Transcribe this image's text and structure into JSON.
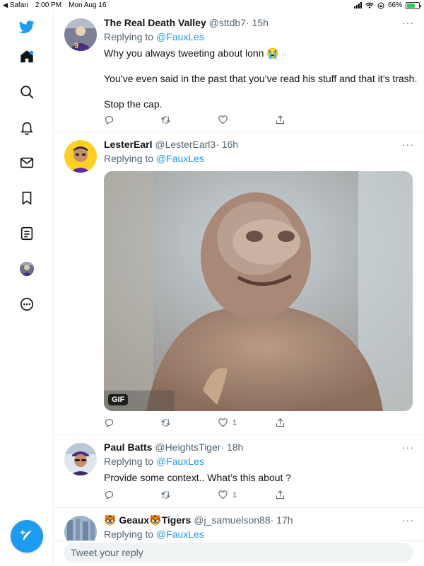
{
  "status_bar": {
    "back_app": "Safari",
    "time": "2:00 PM",
    "date": "Mon Aug 16",
    "battery": "66%",
    "battery_level": 0.66
  },
  "sidebar": {
    "items": [
      {
        "icon": "twitter-bird-icon"
      },
      {
        "icon": "home-icon"
      },
      {
        "icon": "search-icon"
      },
      {
        "icon": "bell-icon"
      },
      {
        "icon": "mail-icon"
      },
      {
        "icon": "bookmark-icon"
      },
      {
        "icon": "list-icon"
      },
      {
        "icon": "profile-avatar"
      },
      {
        "icon": "more-icon"
      }
    ],
    "compose_icon": "compose-icon",
    "accent": "#1d9bf0"
  },
  "tweets": [
    {
      "name": "The Real Death Valley",
      "handle": "@sttdb7",
      "time": "· 15h",
      "replying_prefix": "Replying to",
      "replying_to": "@FauxLes",
      "lines": [
        "Why you always tweeting about lonn 😭",
        "You’ve even said in the past that you’ve read his stuff and that it’s trash.",
        "Stop the cap."
      ],
      "like_count": ""
    },
    {
      "name": "LesterEarl",
      "handle": "@LesterEarl3",
      "time": "· 16h",
      "replying_prefix": "Replying to",
      "replying_to": "@FauxLes",
      "media_badge": "GIF",
      "like_count": "1"
    },
    {
      "name": "Paul Batts",
      "handle": "@HeightsTiger",
      "time": "· 18h",
      "replying_prefix": "Replying to",
      "replying_to": "@FauxLes",
      "lines": [
        "Provide some context.. What’s this about ?"
      ],
      "like_count": "1"
    },
    {
      "name_prefix_emoji": "🐯",
      "name_word1": "Geaux",
      "name_mid_emoji": "🐯",
      "name_word2": "Tigers",
      "handle": "@j_samuelson88",
      "time": "· 17h",
      "replying_prefix": "Replying to",
      "replying_to": "@FauxLes"
    }
  ],
  "reply_bar": {
    "placeholder": "Tweet your reply"
  }
}
